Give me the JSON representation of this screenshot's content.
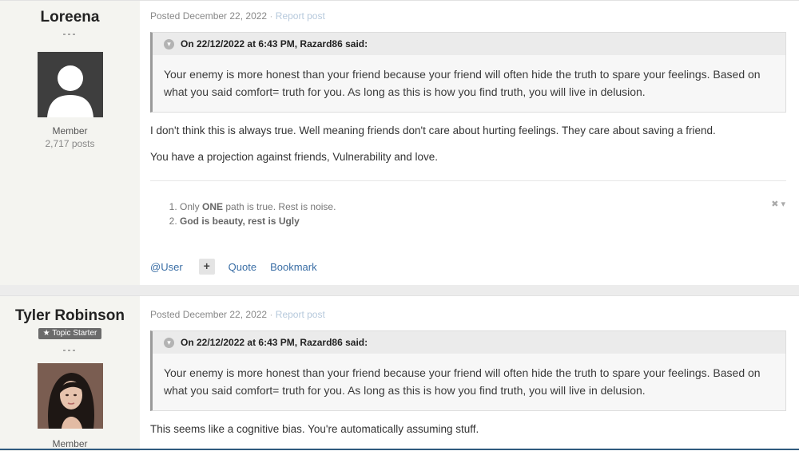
{
  "posts": [
    {
      "author": "Loreena",
      "dashes": "---",
      "role": "Member",
      "post_count": "2,717 posts",
      "posted": "Posted December 22, 2022",
      "separator": "·",
      "report": "Report post",
      "quote_header": "On 22/12/2022 at 6:43 PM, Razard86 said:",
      "quote_text": "Your enemy is more honest than your friend because your friend will often hide the truth to spare your feelings. Based on what you said comfort= truth for you. As long as this is how you find truth, you will live in delusion.",
      "paragraphs": [
        "I don't think this is always true. Well meaning friends don't care about hurting feelings. They care about saving a friend.",
        "You have a projection against friends, Vulnerability and love."
      ],
      "signature": {
        "item1_prefix": "Only ",
        "item1_bold": "ONE",
        "item1_suffix": " path is true. Rest is noise",
        "item1_end": ".",
        "item2": "God is beauty, rest is Ugly",
        "controls": "✖ ▾"
      },
      "actions": {
        "user": "@User",
        "plus": "+",
        "quote": "Quote",
        "bookmark": "Bookmark"
      }
    },
    {
      "author": "Tyler Robinson",
      "badge": "★ Topic Starter",
      "dashes": "---",
      "role": "Member",
      "posted": "Posted December 22, 2022",
      "separator": "·",
      "report": "Report post",
      "quote_header": "On 22/12/2022 at 6:43 PM, Razard86 said:",
      "quote_text": "Your enemy is more honest than your friend because your friend will often hide the truth to spare your feelings. Based on what you said comfort= truth for you. As long as this is how you find truth, you will live in delusion.",
      "paragraphs": [
        "This seems like a cognitive bias. You're automatically assuming stuff."
      ]
    }
  ],
  "icons": {
    "quote_icon": "chevron-down-circle-icon",
    "star_icon": "star-icon"
  },
  "colors": {
    "link": "#3a6ea5",
    "report_link": "#b6c9dc",
    "author_bg": "#f4f4f0"
  }
}
